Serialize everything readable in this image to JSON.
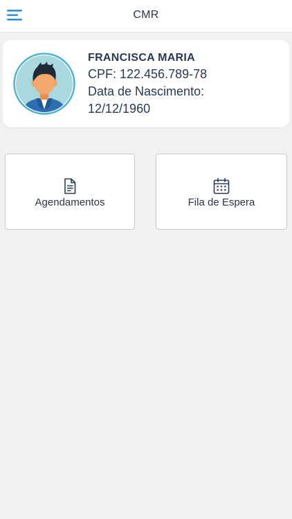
{
  "header": {
    "title": "CMR",
    "menu_icon": "hamburger-menu-icon"
  },
  "profile": {
    "name": "FRANCISCA MARIA",
    "cpf": "CPF: 122.456.789-78",
    "birth_label": "Data de Nascimento:",
    "birth_date": "12/12/1960",
    "avatar_icon": "user-avatar-icon"
  },
  "actions": [
    {
      "label": "Agendamentos",
      "icon": "document-icon"
    },
    {
      "label": "Fila de Espera",
      "icon": "calendar-icon"
    }
  ],
  "colors": {
    "accent": "#2f8fd8",
    "text": "#263a58",
    "background": "#f1f1f1"
  }
}
